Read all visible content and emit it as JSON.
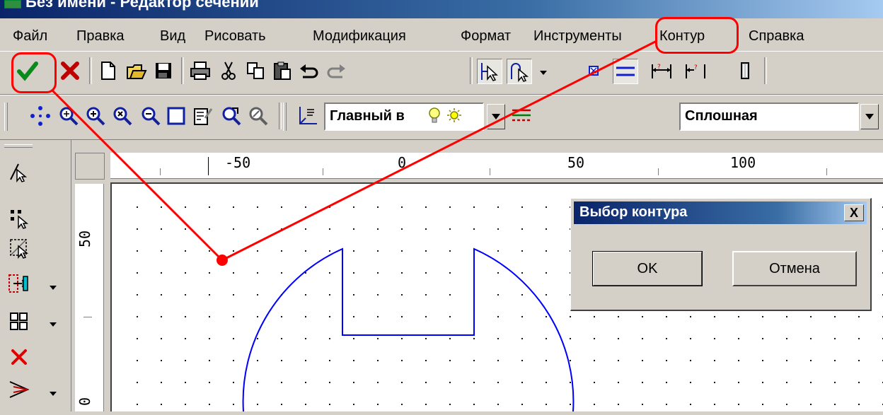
{
  "window": {
    "title": "Без имени - Редактор сечений"
  },
  "menu": {
    "items": [
      "Файл",
      "Правка",
      "Вид",
      "Рисовать",
      "Модификация",
      "Формат",
      "Инструменты",
      "Контур",
      "Справка"
    ]
  },
  "toolbar1": {
    "buttons": [
      "accept-icon",
      "cancel-icon",
      "new-file-icon",
      "open-folder-icon",
      "save-icon",
      "print-icon",
      "cut-icon",
      "copy-icon",
      "paste-icon",
      "undo-icon",
      "redo-icon",
      "select-pointer-icon",
      "contour-select-icon",
      "small-rect-icon",
      "parallel-lines-icon",
      "dimension-icon",
      "dimension-query-icon",
      "column-icon"
    ]
  },
  "toolbar2": {
    "buttons": [
      "pan-icon",
      "zoom-window-icon",
      "zoom-in-icon",
      "zoom-extents-icon",
      "zoom-out-icon",
      "frame-icon",
      "properties-icon",
      "zoom-realtime-icon",
      "zoom-previous-icon",
      "layer-icon"
    ],
    "layer_combo": "Главный в",
    "linetype_combo": "Сплошная"
  },
  "left_toolbar": {
    "buttons": [
      "select-arrow-icon",
      "select-points-icon",
      "select-window-icon",
      "insert-block-icon",
      "group-icon",
      "delete-icon",
      "angle-icon"
    ]
  },
  "ruler": {
    "top_labels": [
      "-50",
      "0",
      "50",
      "100"
    ],
    "left_labels": [
      "50",
      "0"
    ]
  },
  "dialog": {
    "title": "Выбор контура",
    "close_label": "X",
    "ok_label": "OK",
    "cancel_label": "Отмена"
  },
  "colors": {
    "annotation": "#ff0000",
    "contour": "#0000ff",
    "titlebar": "#0a246a"
  }
}
